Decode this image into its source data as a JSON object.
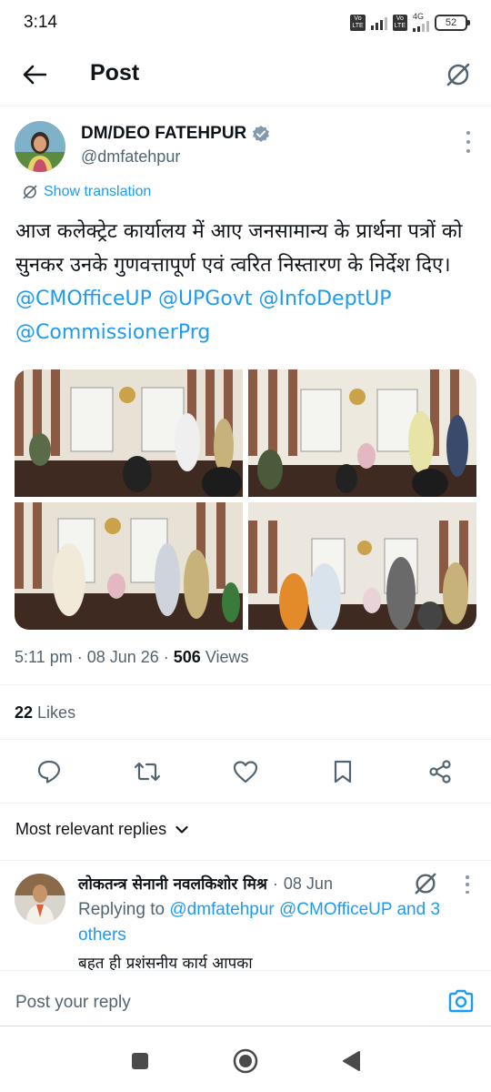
{
  "status_bar": {
    "time": "3:14",
    "sim1_label": "Vo LTE",
    "sim2_label": "Vo LTE",
    "network": "4G",
    "battery": "52"
  },
  "header": {
    "title": "Post",
    "back_icon": "arrow-left-icon",
    "grok_icon": "slash-circle-icon"
  },
  "post": {
    "author_name": "DM/DEO FATEHPUR",
    "author_handle": "@dmfatehpur",
    "translate_label": "Show translation",
    "text_hindi": "आज कलेक्ट्रेट कार्यालय में आए जनसामान्य के प्रार्थना पत्रों को सुनकर उनके  गुणवत्तापूर्ण एवं त्वरित निस्तारण के निर्देश दिए।",
    "mentions": [
      "@CMOfficeUP",
      "@UPGovt",
      "@InfoDeptUP",
      "@CommissionerPrg"
    ],
    "time": "5:11 pm",
    "date": "08 Jun 26",
    "views_count": "506",
    "views_label": "Views",
    "likes_count": "22",
    "likes_label": "Likes"
  },
  "sort_label": "Most relevant replies",
  "reply": {
    "name": "लोकतन्त्र सेनानी नवलकिशोर मिश्र",
    "date": "08 Jun",
    "replying_prefix": "Replying to",
    "replying_mentions": "@dmfatehpur @CMOfficeUP and 3 others",
    "text": "बहत ही प्रशंसनीय कार्य आपका"
  },
  "compose": {
    "placeholder": "Post your reply"
  },
  "colors": {
    "accent": "#1d9bf0",
    "text": "#0f1419",
    "secondary": "#536471"
  }
}
